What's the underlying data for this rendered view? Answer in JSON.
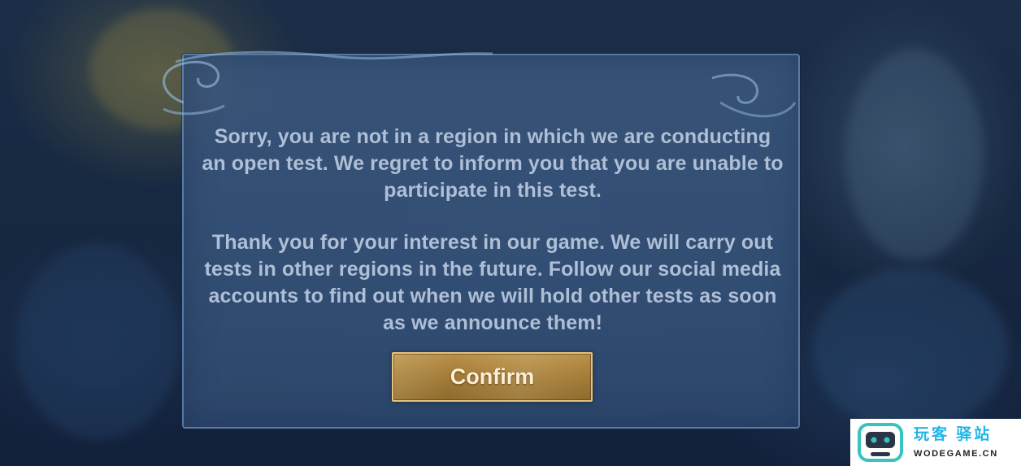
{
  "dialog": {
    "paragraphs": [
      "Sorry, you are not in a region in which we are conducting an open test. We regret to inform you that you are unable to participate in this test.",
      "Thank you for your interest in our game. We will carry out tests in other regions in the future. Follow our social media accounts to find out when we will hold other tests as soon as we announce them!"
    ],
    "confirm_label": "Confirm"
  },
  "watermark": {
    "title": "玩客 驿站",
    "domain": "WODEGAME.CN",
    "icon": "robot-face-icon"
  },
  "colors": {
    "dialog_text": "#aebfd6",
    "button_gold": "#a27a36",
    "button_border": "#e6c27a",
    "watermark_accent": "#1fb5e8"
  }
}
